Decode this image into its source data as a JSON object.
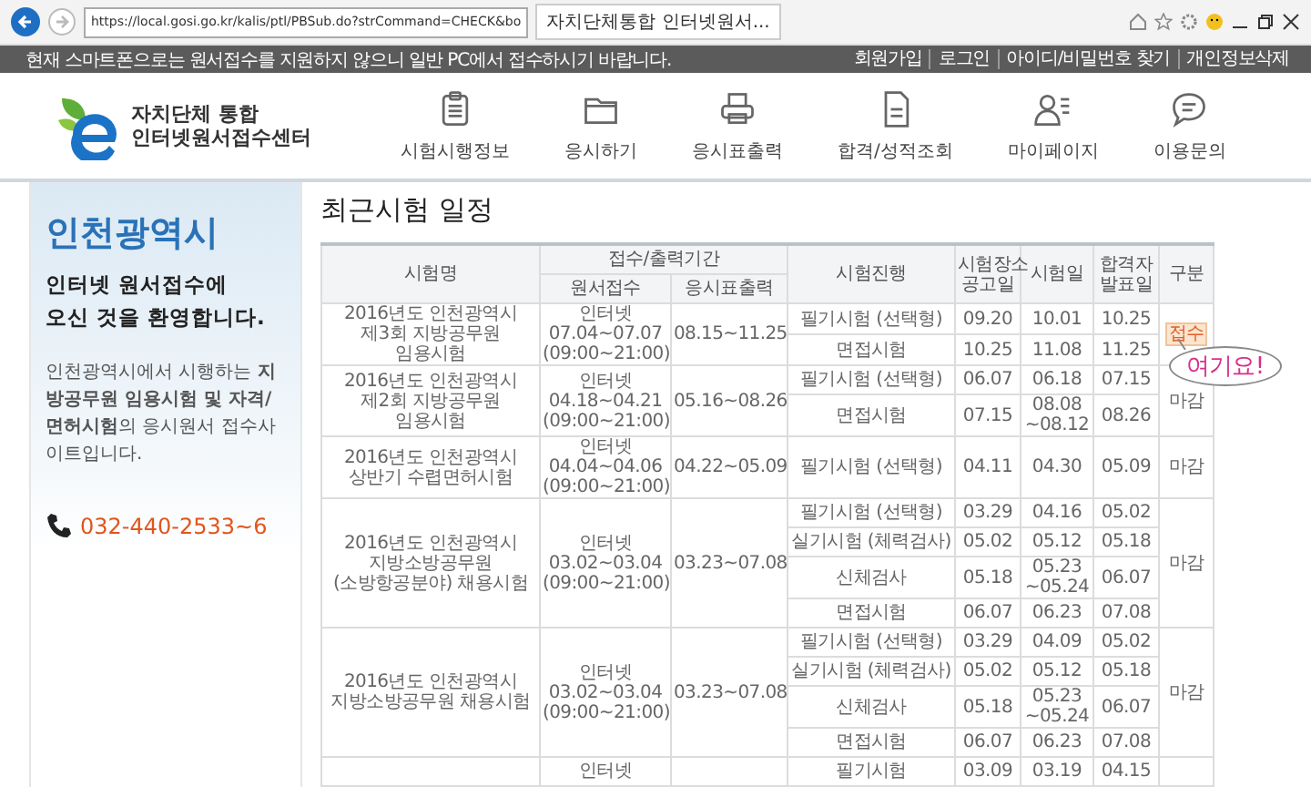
{
  "browser": {
    "address": "https://local.gosi.go.kr/kalis/ptl/PBSub.do?strCommand=CHECK&bo",
    "tab": "자치단체통합 인터넷원서..."
  },
  "notice_bar": {
    "message": "현재 스마트폰으로는 원서접수를 지원하지 않으니 일반 PC에서 접수하시기 바랍니다.",
    "links": [
      "회원가입",
      "로그인",
      "아이디/비밀번호 찾기",
      "개인정보삭제"
    ]
  },
  "logo": {
    "line1": "자치단체 통합",
    "line2": "인터넷원서접수센터"
  },
  "nav": [
    "시험시행정보",
    "응시하기",
    "응시표출력",
    "합격/성적조회",
    "마이페이지",
    "이용문의"
  ],
  "sidebar": {
    "region": "인천광역시",
    "welcome": [
      "인터넷 원서접수에",
      "오신 것을 환영합니다."
    ],
    "description": "인천광역시에서 시행하는 **지방공무원 임용시험 및 자격/면허시험**의 응시원서 접수사이트입니다.",
    "phone": "032-440-2533~6"
  },
  "schedule": {
    "title": "최근시험 일정",
    "columns": {
      "name": "시험명",
      "period_group": "접수/출력기간",
      "application": "원서접수",
      "ticket": "응시표출력",
      "stage": "시험진행",
      "notice": "시험장소 공고일",
      "exam": "시험일",
      "result": "합격자 발표일",
      "status": "구분"
    },
    "exams": [
      {
        "name": "2016년도 인천광역시 제3회 지방공무원 임용시험",
        "application": [
          "인터넷",
          "07.04~07.07",
          "(09:00~21:00)"
        ],
        "ticket": "08.15~11.25",
        "status": "접수",
        "open": true,
        "stages": [
          {
            "stage": "필기시험 (선택형)",
            "notice": "09.20",
            "exam": "10.01",
            "result": "10.25"
          },
          {
            "stage": "면접시험",
            "notice": "10.25",
            "exam": "11.08",
            "result": "11.25"
          }
        ]
      },
      {
        "name": "2016년도 인천광역시 제2회 지방공무원 임용시험",
        "application": [
          "인터넷",
          "04.18~04.21",
          "(09:00~21:00)"
        ],
        "ticket": "05.16~08.26",
        "status": "마감",
        "open": false,
        "stages": [
          {
            "stage": "필기시험 (선택형)",
            "notice": "06.07",
            "exam": "06.18",
            "result": "07.15"
          },
          {
            "stage": "면접시험",
            "notice": "07.15",
            "exam": "08.08 ~08.12",
            "result": "08.26"
          }
        ]
      },
      {
        "name": "2016년도 인천광역시 상반기 수렵면허시험",
        "application": [
          "인터넷",
          "04.04~04.06",
          "(09:00~21:00)"
        ],
        "ticket": "04.22~05.09",
        "status": "마감",
        "open": false,
        "stages": [
          {
            "stage": "필기시험 (선택형)",
            "notice": "04.11",
            "exam": "04.30",
            "result": "05.09"
          }
        ]
      },
      {
        "name": "2016년도 인천광역시 지방소방공무원(소방항공분야) 채용시험",
        "application": [
          "인터넷",
          "03.02~03.04",
          "(09:00~21:00)"
        ],
        "ticket": "03.23~07.08",
        "status": "마감",
        "open": false,
        "stages": [
          {
            "stage": "필기시험 (선택형)",
            "notice": "03.29",
            "exam": "04.16",
            "result": "05.02"
          },
          {
            "stage": "실기시험 (체력검사)",
            "notice": "05.02",
            "exam": "05.12",
            "result": "05.18"
          },
          {
            "stage": "신체검사",
            "notice": "05.18",
            "exam": "05.23 ~05.24",
            "result": "06.07"
          },
          {
            "stage": "면접시험",
            "notice": "06.07",
            "exam": "06.23",
            "result": "07.08"
          }
        ]
      },
      {
        "name": "2016년도 인천광역시 지방소방공무원 채용시험",
        "application": [
          "인터넷",
          "03.02~03.04",
          "(09:00~21:00)"
        ],
        "ticket": "03.23~07.08",
        "status": "마감",
        "open": false,
        "stages": [
          {
            "stage": "필기시험 (선택형)",
            "notice": "03.29",
            "exam": "04.09",
            "result": "05.02"
          },
          {
            "stage": "실기시험 (체력검사)",
            "notice": "05.02",
            "exam": "05.12",
            "result": "05.18"
          },
          {
            "stage": "신체검사",
            "notice": "05.18",
            "exam": "05.23 ~05.24",
            "result": "06.07"
          },
          {
            "stage": "면접시험",
            "notice": "06.07",
            "exam": "06.23",
            "result": "07.08"
          }
        ]
      },
      {
        "application": [
          "인터넷"
        ],
        "stages": [
          {
            "stage": "필기시험",
            "notice": "03.09",
            "exam": "03.19",
            "result": "04.15"
          }
        ]
      }
    ]
  },
  "callout": "여기요!"
}
